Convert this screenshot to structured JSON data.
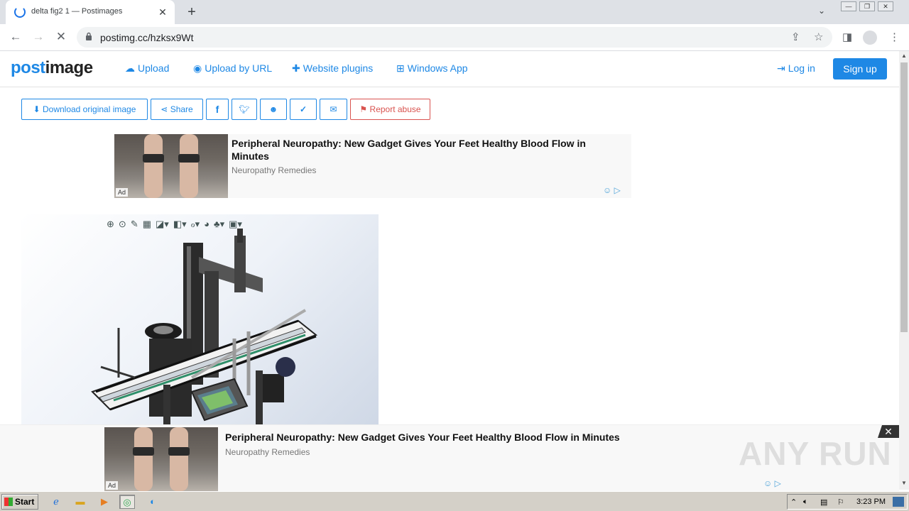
{
  "browser": {
    "tab_title": "delta fig2 1 — Postimages",
    "url": "postimg.cc/hzksx9Wt"
  },
  "site": {
    "logo_part1": "post",
    "logo_part2": "image",
    "nav": {
      "upload": "Upload",
      "upload_url": "Upload by URL",
      "plugins": "Website plugins",
      "windows_app": "Windows App",
      "login": "Log in",
      "signup": "Sign up"
    }
  },
  "actions": {
    "download": "Download original image",
    "share": "Share",
    "facebook": "f",
    "report": "Report abuse"
  },
  "ad_top": {
    "headline": "Peripheral Neuropathy: New Gadget Gives Your Feet Healthy Blood Flow in Minutes",
    "advertiser": "Neuropathy Remedies",
    "tag": "Ad"
  },
  "ad_bottom": {
    "headline": "Peripheral Neuropathy: New Gadget Gives Your Feet Healthy Blood Flow in Minutes",
    "advertiser": "Neuropathy Remedies",
    "tag": "Ad"
  },
  "watermark": "ANY RUN",
  "taskbar": {
    "start": "Start",
    "clock": "3:23 PM"
  }
}
